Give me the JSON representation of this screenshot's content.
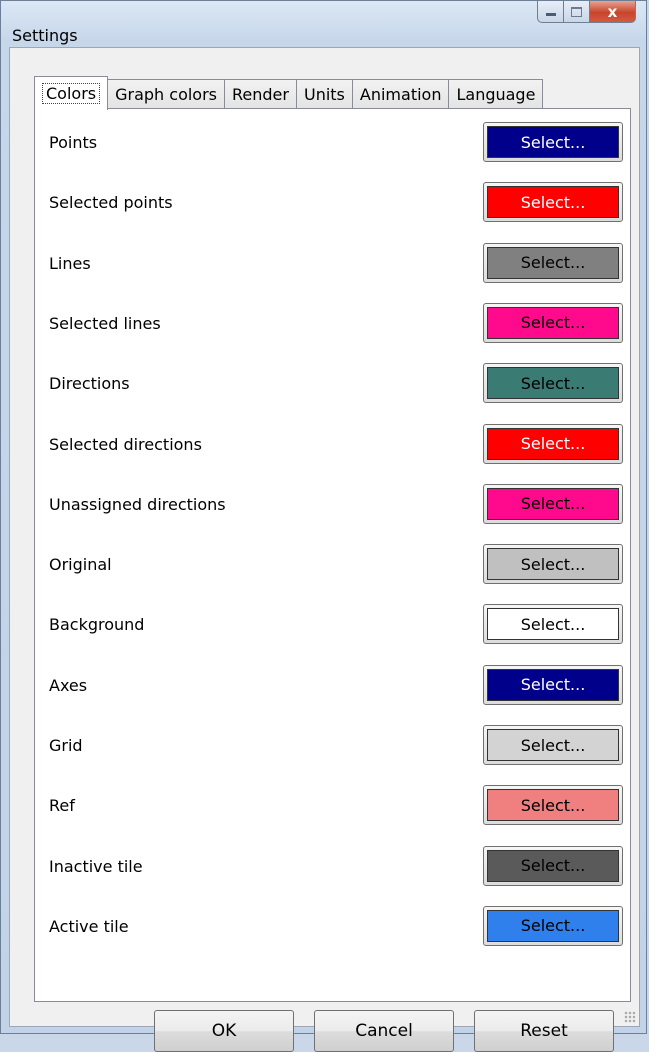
{
  "window": {
    "title": "Settings",
    "close_glyph": "x"
  },
  "tabs": [
    {
      "label": "Colors",
      "active": true
    },
    {
      "label": "Graph colors",
      "active": false
    },
    {
      "label": "Render",
      "active": false
    },
    {
      "label": "Units",
      "active": false
    },
    {
      "label": "Animation",
      "active": false
    },
    {
      "label": "Language",
      "active": false
    }
  ],
  "colors": [
    {
      "label": "Points",
      "button": "Select...",
      "color": "#00008b",
      "text_color": "#ffffff"
    },
    {
      "label": "Selected points",
      "button": "Select...",
      "color": "#ff0000",
      "text_color": "#ffffff"
    },
    {
      "label": "Lines",
      "button": "Select...",
      "color": "#808080",
      "text_color": "#000000"
    },
    {
      "label": "Selected lines",
      "button": "Select...",
      "color": "#ff0a8c",
      "text_color": "#000000"
    },
    {
      "label": "Directions",
      "button": "Select...",
      "color": "#3a7b74",
      "text_color": "#000000"
    },
    {
      "label": "Selected directions",
      "button": "Select...",
      "color": "#ff0000",
      "text_color": "#ffffff"
    },
    {
      "label": "Unassigned directions",
      "button": "Select...",
      "color": "#ff0a8c",
      "text_color": "#000000"
    },
    {
      "label": "Original",
      "button": "Select...",
      "color": "#c0c0c0",
      "text_color": "#000000"
    },
    {
      "label": "Background",
      "button": "Select...",
      "color": "#ffffff",
      "text_color": "#000000"
    },
    {
      "label": "Axes",
      "button": "Select...",
      "color": "#00008b",
      "text_color": "#ffffff"
    },
    {
      "label": "Grid",
      "button": "Select...",
      "color": "#d3d3d3",
      "text_color": "#000000"
    },
    {
      "label": "Ref",
      "button": "Select...",
      "color": "#f08080",
      "text_color": "#000000"
    },
    {
      "label": "Inactive tile",
      "button": "Select...",
      "color": "#5a5a5a",
      "text_color": "#000000"
    },
    {
      "label": "Active tile",
      "button": "Select...",
      "color": "#2f80ed",
      "text_color": "#000000"
    }
  ],
  "buttons": {
    "ok": "OK",
    "cancel": "Cancel",
    "reset": "Reset"
  }
}
